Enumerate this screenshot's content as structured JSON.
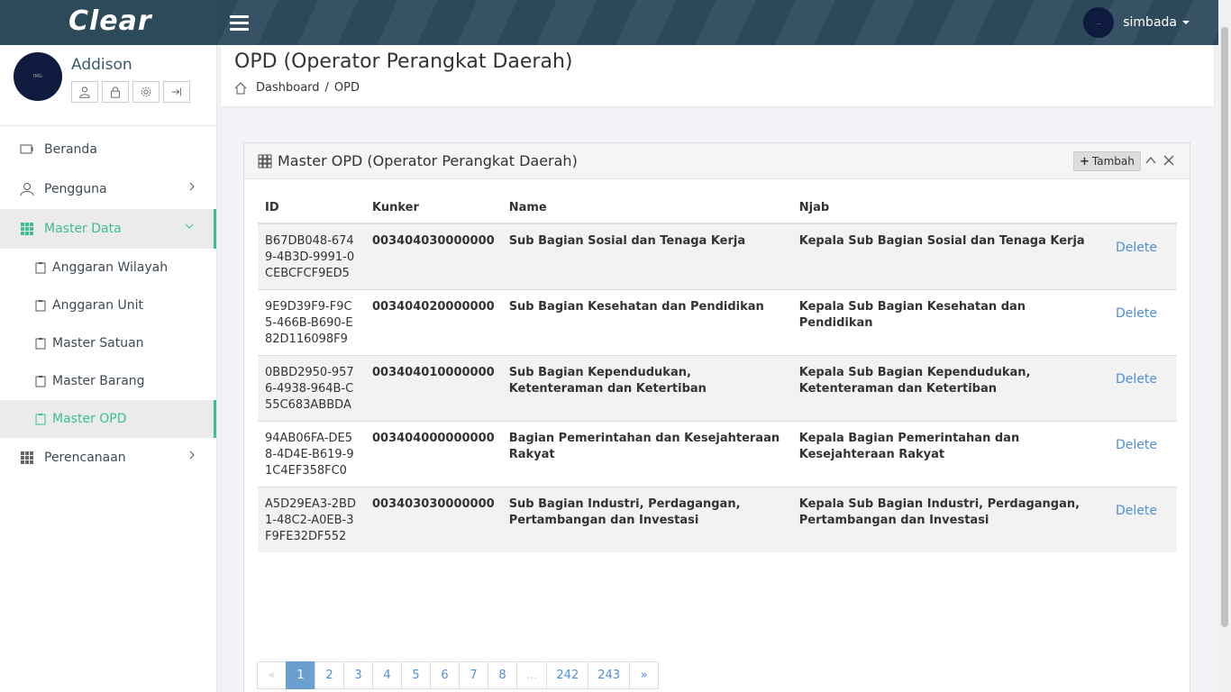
{
  "app": {
    "logo": "Clear"
  },
  "topbar": {
    "username": "simbada",
    "avatar_text": "..."
  },
  "sidebar": {
    "profile_name": "Addison",
    "avatar_text": "IMG",
    "menu": [
      {
        "label": "Beranda"
      },
      {
        "label": "Pengguna"
      },
      {
        "label": "Master Data"
      },
      {
        "label": "Perencanaan"
      }
    ],
    "submenu": [
      {
        "label": "Anggaran Wilayah"
      },
      {
        "label": "Anggaran Unit"
      },
      {
        "label": "Master Satuan"
      },
      {
        "label": "Master Barang"
      },
      {
        "label": "Master OPD"
      }
    ]
  },
  "page": {
    "title": "OPD (Operator Perangkat Daerah)",
    "breadcrumb": {
      "home": "Dashboard",
      "sep": "/",
      "current": "OPD"
    }
  },
  "card": {
    "title": "Master OPD (Operator Perangkat Daerah)",
    "add_button": "Tambah",
    "columns": [
      "ID",
      "Kunker",
      "Name",
      "Njab"
    ],
    "rows": [
      {
        "id": "B67DB048-6749-4B3D-9991-0CEBCFCF9ED5",
        "kunker": "003404030000000",
        "name": "Sub Bagian Sosial dan Tenaga Kerja",
        "njab": "Kepala Sub Bagian Sosial dan Tenaga Kerja",
        "action": "Delete"
      },
      {
        "id": "9E9D39F9-F9C5-466B-B690-E82D116098F9",
        "kunker": "003404020000000",
        "name": "Sub Bagian Kesehatan dan Pendidikan",
        "njab": "Kepala Sub Bagian Kesehatan dan Pendidikan",
        "action": "Delete"
      },
      {
        "id": "0BBD2950-9576-4938-964B-C55C683ABBDA",
        "kunker": "003404010000000",
        "name": "Sub Bagian Kependudukan, Ketenteraman dan Ketertiban",
        "njab": "Kepala Sub Bagian Kependudukan, Ketenteraman dan Ketertiban",
        "action": "Delete"
      },
      {
        "id": "94AB06FA-DE58-4D4E-B619-91C4EF358FC0",
        "kunker": "003404000000000",
        "name": "Bagian Pemerintahan dan Kesejahteraan Rakyat",
        "njab": "Kepala Bagian Pemerintahan dan Kesejahteraan Rakyat",
        "action": "Delete"
      },
      {
        "id": "A5D29EA3-2BD1-48C2-A0EB-3F9FE32DF552",
        "kunker": "003403030000000",
        "name": "Sub Bagian Industri, Perdagangan, Pertambangan dan Investasi",
        "njab": "Kepala Sub Bagian Industri, Perdagangan, Pertambangan dan Investasi",
        "action": "Delete"
      }
    ]
  },
  "pagination": {
    "prev": "«",
    "next": "»",
    "pages": [
      "1",
      "2",
      "3",
      "4",
      "5",
      "6",
      "7",
      "8",
      "...",
      "242",
      "243"
    ],
    "current": "1"
  }
}
